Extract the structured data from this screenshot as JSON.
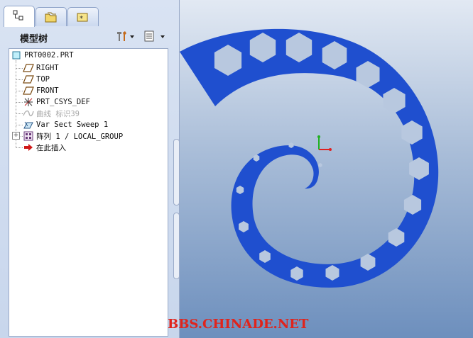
{
  "tabs": [
    {
      "icon": "model-tree-icon",
      "active": true
    },
    {
      "icon": "folder-browser-icon",
      "active": false
    },
    {
      "icon": "favorites-icon",
      "active": false
    }
  ],
  "panel": {
    "title": "模型树",
    "settings_icon": "tools-icon",
    "show_icon": "list-icon"
  },
  "tree": {
    "root": "PRT0002.PRT",
    "items": [
      {
        "label": "RIGHT",
        "icon": "datum-plane-icon",
        "dim": false
      },
      {
        "label": "TOP",
        "icon": "datum-plane-icon",
        "dim": false
      },
      {
        "label": "FRONT",
        "icon": "datum-plane-icon",
        "dim": false
      },
      {
        "label": "PRT_CSYS_DEF",
        "icon": "coordinate-system-icon",
        "dim": false
      },
      {
        "label": "曲线 标识39",
        "icon": "curve-icon",
        "dim": true
      },
      {
        "label": "Var Sect Sweep 1",
        "icon": "sweep-icon",
        "dim": false
      },
      {
        "label": "阵列 1 / LOCAL_GROUP",
        "icon": "pattern-icon",
        "dim": false,
        "expandable": true
      },
      {
        "label": "在此插入",
        "icon": "insert-here-arrow-icon",
        "dim": false
      }
    ]
  },
  "watermark": "BBS.CHINADE.NET",
  "colors": {
    "part": "#1f4fcf",
    "hole": "#b8c8df",
    "axis_x": "#e02020",
    "axis_y": "#20b020"
  }
}
